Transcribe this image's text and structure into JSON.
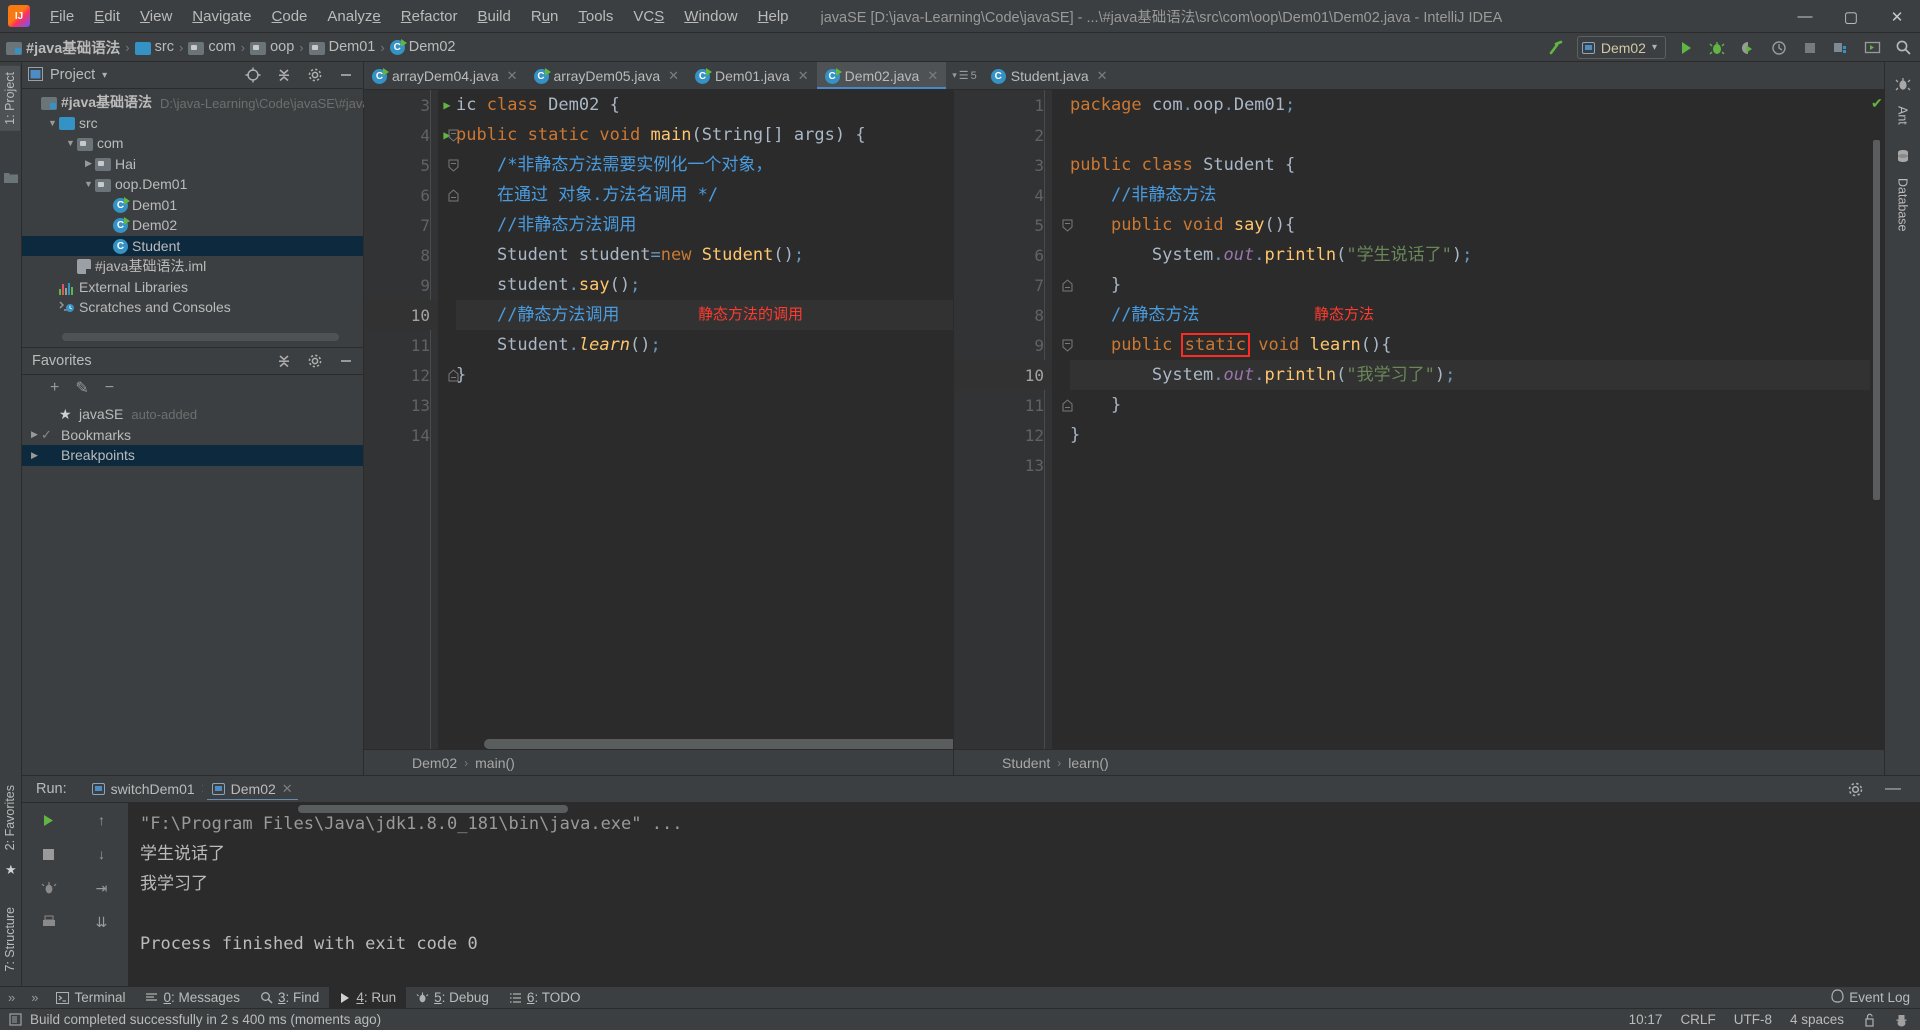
{
  "titlebar": {
    "menus": [
      {
        "pre": "",
        "mn": "F",
        "post": "ile"
      },
      {
        "pre": "",
        "mn": "E",
        "post": "dit"
      },
      {
        "pre": "",
        "mn": "V",
        "post": "iew"
      },
      {
        "pre": "",
        "mn": "N",
        "post": "avigate"
      },
      {
        "pre": "",
        "mn": "C",
        "post": "ode"
      },
      {
        "pre": "Analyz",
        "mn": "e",
        "post": ""
      },
      {
        "pre": "",
        "mn": "R",
        "post": "efactor"
      },
      {
        "pre": "",
        "mn": "B",
        "post": "uild"
      },
      {
        "pre": "R",
        "mn": "u",
        "post": "n"
      },
      {
        "pre": "",
        "mn": "T",
        "post": "ools"
      },
      {
        "pre": "VC",
        "mn": "S",
        "post": ""
      },
      {
        "pre": "",
        "mn": "W",
        "post": "indow"
      },
      {
        "pre": "",
        "mn": "H",
        "post": "elp"
      }
    ],
    "window_title": "javaSE [D:\\java-Learning\\Code\\javaSE] - ...\\#java基础语法\\src\\com\\oop\\Dem01\\Dem02.java - IntelliJ IDEA",
    "minimize": "—",
    "maximize": "▢",
    "close": "✕"
  },
  "navbar": {
    "crumbs": [
      "#java基础语法",
      "src",
      "com",
      "oop",
      "Dem01",
      "Dem02"
    ],
    "separator": "›",
    "run_config": "Dem02",
    "dropdown_arrow": "▾"
  },
  "left_strip": {
    "project_tab": "1: Project",
    "favorites_tab": "2: Favorites",
    "structure_tab": "7: Structure"
  },
  "right_strip": {
    "ant_tab": "Ant",
    "database_tab": "Database"
  },
  "project_panel": {
    "title": "Project",
    "title_arrow": "▾",
    "tree": [
      {
        "indent": 0,
        "arrow": "",
        "icon": "module",
        "label": "#java基础语法",
        "bold": true,
        "sub": "D:\\java-Learning\\Code\\javaSE\\#java基础",
        "selected": false
      },
      {
        "indent": 1,
        "arrow": "▼",
        "icon": "src",
        "label": "src",
        "bold": false,
        "sub": "",
        "selected": false
      },
      {
        "indent": 2,
        "arrow": "▼",
        "icon": "pkg",
        "label": "com",
        "bold": false,
        "sub": "",
        "selected": false
      },
      {
        "indent": 3,
        "arrow": "▶",
        "icon": "pkg",
        "label": "Hai",
        "bold": false,
        "sub": "",
        "selected": false
      },
      {
        "indent": 3,
        "arrow": "▼",
        "icon": "pkg",
        "label": "oop.Dem01",
        "bold": false,
        "sub": "",
        "selected": false
      },
      {
        "indent": 4,
        "arrow": "",
        "icon": "class-run",
        "label": "Dem01",
        "bold": false,
        "sub": "",
        "selected": false
      },
      {
        "indent": 4,
        "arrow": "",
        "icon": "class-run",
        "label": "Dem02",
        "bold": false,
        "sub": "",
        "selected": false
      },
      {
        "indent": 4,
        "arrow": "",
        "icon": "class",
        "label": "Student",
        "bold": false,
        "sub": "",
        "selected": true
      },
      {
        "indent": 2,
        "arrow": "",
        "icon": "iml",
        "label": "#java基础语法.iml",
        "bold": false,
        "sub": "",
        "selected": false
      },
      {
        "indent": 1,
        "arrow": "",
        "icon": "lib",
        "label": "External Libraries",
        "bold": false,
        "sub": "",
        "selected": false
      },
      {
        "indent": 1,
        "arrow": "",
        "icon": "scratch",
        "label": "Scratches and Consoles",
        "bold": false,
        "sub": "",
        "selected": false
      }
    ]
  },
  "favorites_panel": {
    "title": "Favorites",
    "toolbar": {
      "add": "+",
      "edit": "✎",
      "remove": "−"
    },
    "tree": [
      {
        "indent": 1,
        "arrow": "",
        "icon": "star",
        "label": "javaSE",
        "sub": "auto-added",
        "selected": false
      },
      {
        "indent": 0,
        "arrow": "▶",
        "icon": "check",
        "label": "Bookmarks",
        "sub": "",
        "selected": false
      },
      {
        "indent": 0,
        "arrow": "▶",
        "icon": "bp",
        "label": "Breakpoints",
        "sub": "",
        "selected": true
      }
    ]
  },
  "editor": {
    "tabs": [
      {
        "label": "arrayDem04.java",
        "active": false,
        "icon": "class-run"
      },
      {
        "label": "arrayDem05.java",
        "active": false,
        "icon": "class-run"
      },
      {
        "label": "Dem01.java",
        "active": false,
        "icon": "class-run"
      },
      {
        "label": "Dem02.java",
        "active": true,
        "icon": "class-run"
      },
      {
        "label": "Student.java",
        "active": false,
        "icon": "class"
      }
    ],
    "tab_overflow": "5",
    "close_glyph": "✕",
    "left_pane": {
      "line_numbers": [
        "3",
        "4",
        "5",
        "6",
        "7",
        "8",
        "9",
        "10",
        "11",
        "12",
        "13",
        "14"
      ],
      "current_line": "10",
      "lines": [
        "ic class Dem02 {",
        "public static void main(String[] args) {",
        "    /*非静态方法需要实例化一个对象，",
        "    在通过 对象.方法名调用 */",
        "    //非静态方法调用",
        "    Student student=new Student();",
        "    student.say();",
        "    //静态方法调用",
        "    Student.learn();",
        "}",
        "",
        ""
      ],
      "annotation": "静态方法的调用",
      "breadcrumb": [
        "Dem02",
        "main()"
      ]
    },
    "right_pane": {
      "line_numbers": [
        "1",
        "2",
        "3",
        "4",
        "5",
        "6",
        "7",
        "8",
        "9",
        "10",
        "11",
        "12",
        "13"
      ],
      "current_line": "10",
      "lines": [
        "package com.oop.Dem01;",
        "",
        "public class Student {",
        "    //非静态方法",
        "    public void say(){",
        "        System.out.println(\"学生说话了\");",
        "    }",
        "    //静态方法",
        "    public static void learn(){",
        "        System.out.println(\"我学习了\");",
        "    }",
        "}",
        ""
      ],
      "annotation": "静态方法",
      "highlight_token": "static",
      "breadcrumb": [
        "Student",
        "learn()"
      ]
    }
  },
  "run_panel": {
    "label": "Run:",
    "tabs": [
      {
        "label": "switchDem01",
        "active": false
      },
      {
        "label": "Dem02",
        "active": true
      }
    ],
    "close_glyph": "✕",
    "console": [
      "\"F:\\Program Files\\Java\\jdk1.8.0_181\\bin\\java.exe\" ...",
      "学生说话了",
      "我学习了",
      "",
      "Process finished with exit code 0"
    ],
    "settings_icon": "⚙",
    "minimize_icon": "—"
  },
  "bottom_tabs": [
    {
      "label": "Terminal",
      "mnemonic": "",
      "icon": "terminal",
      "active": false
    },
    {
      "label": ": Messages",
      "mnemonic": "0",
      "icon": "messages",
      "active": false
    },
    {
      "label": ": Find",
      "mnemonic": "3",
      "icon": "find",
      "active": false
    },
    {
      "label": ": Run",
      "mnemonic": "4",
      "icon": "run",
      "active": true
    },
    {
      "label": ": Debug",
      "mnemonic": "5",
      "icon": "debug",
      "active": false
    },
    {
      "label": ": TODO",
      "mnemonic": "6",
      "icon": "todo",
      "active": false
    }
  ],
  "event_log": "Event Log",
  "status": {
    "message": "Build completed successfully in 2 s 400 ms (moments ago)",
    "caret": "10:17",
    "line_sep": "CRLF",
    "encoding": "UTF-8",
    "indent": "4 spaces"
  }
}
